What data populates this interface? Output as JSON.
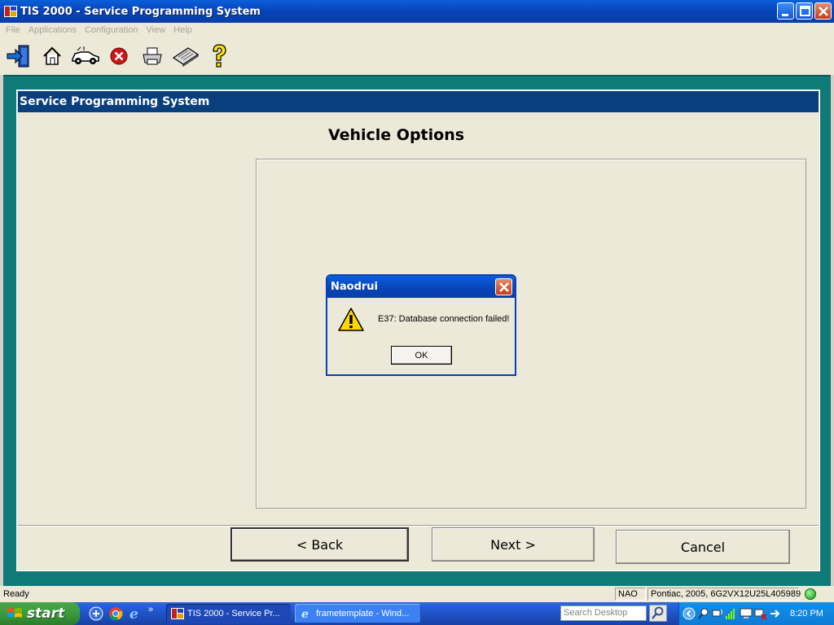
{
  "window": {
    "title": "TIS 2000 - Service Programming System"
  },
  "menu": [
    "File",
    "Applications",
    "Configuration",
    "View",
    "Help"
  ],
  "toolbar": {
    "icons": [
      "exit-icon",
      "home-icon",
      "vehicle-icon",
      "stop-icon",
      "print-icon",
      "keyboard-icon",
      "help-icon"
    ]
  },
  "panel": {
    "header": "Service Programming System",
    "heading": "Vehicle Options"
  },
  "nav": {
    "back": "< Back",
    "next": "Next >",
    "cancel": "Cancel"
  },
  "dialog": {
    "title": "Naodrui",
    "message": "E37: Database connection failed!",
    "ok": "OK"
  },
  "status": {
    "ready": "Ready",
    "region": "NAO",
    "vehicle": "Pontiac, 2005, 6G2VX12U25L405989"
  },
  "taskbar": {
    "start": "start",
    "tasks": [
      "TIS 2000 - Service Pr...",
      "frametemplate - Wind..."
    ],
    "search_placeholder": "Search Desktop",
    "clock": "8:20 PM"
  },
  "colors": {
    "titlebar": "#0842b8",
    "background": "#0f7a78",
    "panel_header": "#0a3f7e",
    "panel": "#ece9d8",
    "taskbar": "#245edb"
  }
}
